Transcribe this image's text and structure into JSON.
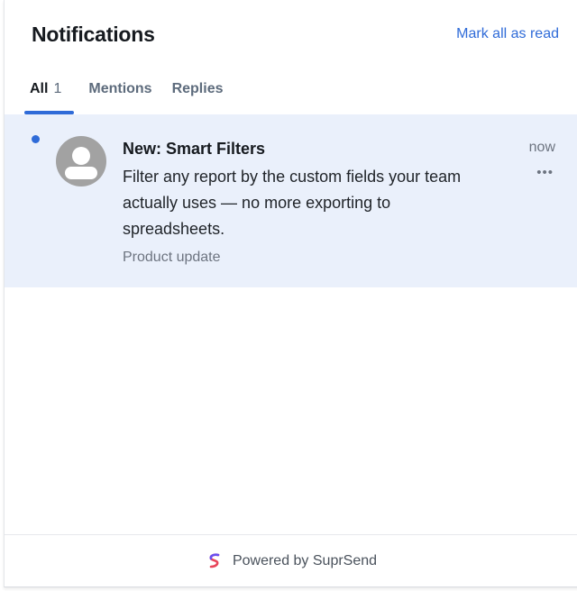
{
  "header": {
    "title": "Notifications",
    "mark_all_read": "Mark all as read"
  },
  "tabs": [
    {
      "label": "All",
      "count": "1",
      "active": true
    },
    {
      "label": "Mentions",
      "active": false
    },
    {
      "label": "Replies",
      "active": false
    }
  ],
  "notifications": [
    {
      "unread": true,
      "avatar_icon": "user-avatar-icon",
      "title": "New: Smart Filters",
      "body": "Filter any report by the custom fields your team actually uses — no more exporting to spreadsheets.",
      "category": "Product update",
      "time": "now",
      "more_icon": "ellipsis-icon"
    }
  ],
  "footer": {
    "powered_by": "Powered by SuprSend",
    "brand_icon": "suprsend-logo-icon"
  },
  "colors": {
    "accent": "#2f6bd8",
    "unread_background": "#eaf0fb",
    "avatar": "#a2a2a2"
  }
}
